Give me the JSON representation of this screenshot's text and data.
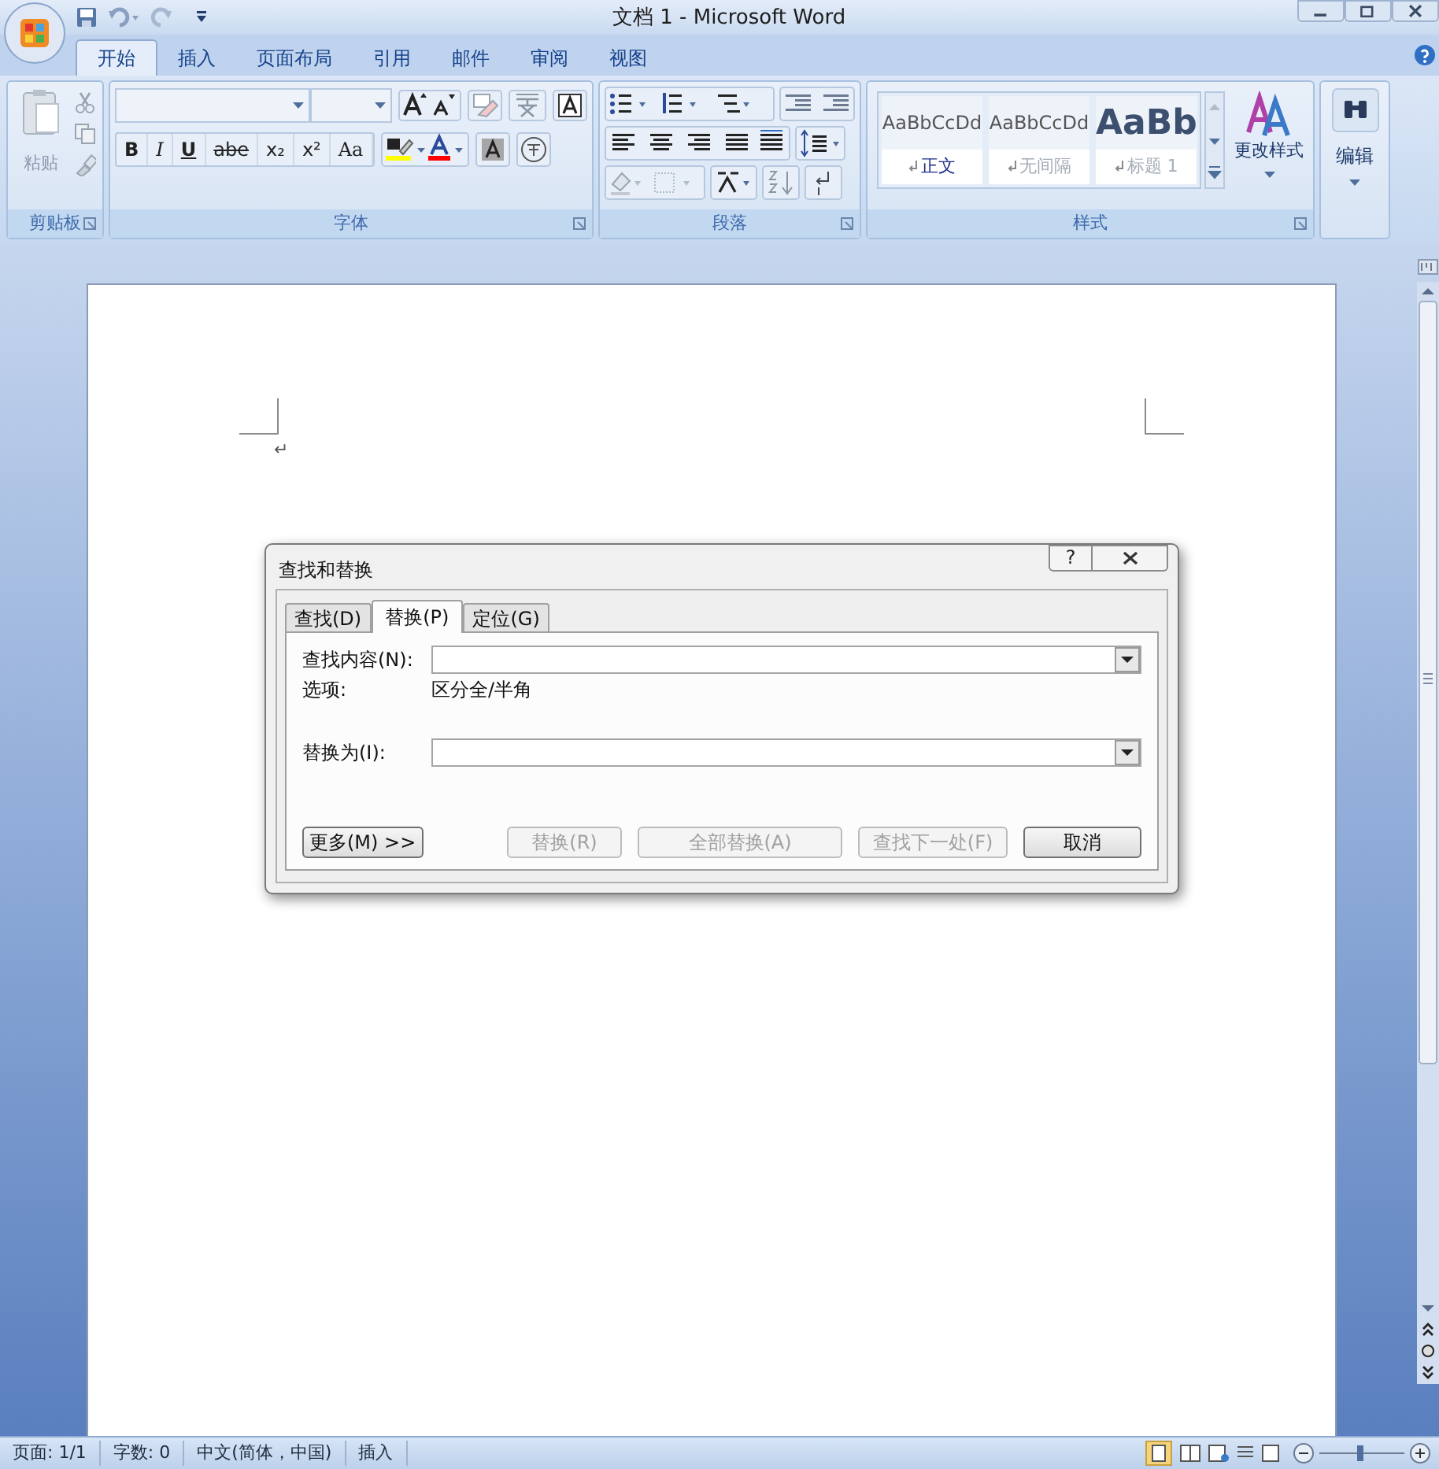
{
  "window": {
    "title": "文档 1 - Microsoft Word"
  },
  "ribbon_tabs": [
    {
      "label": "开始",
      "selected": true
    },
    {
      "label": "插入",
      "selected": false
    },
    {
      "label": "页面布局",
      "selected": false
    },
    {
      "label": "引用",
      "selected": false
    },
    {
      "label": "邮件",
      "selected": false
    },
    {
      "label": "审阅",
      "selected": false
    },
    {
      "label": "视图",
      "selected": false
    }
  ],
  "clipboard_group": {
    "label": "剪贴板",
    "paste_label": "粘贴"
  },
  "font_group": {
    "label": "字体",
    "format_buttons": [
      "B",
      "I",
      "U",
      "abe",
      "x₂",
      "x²",
      "Aa"
    ]
  },
  "paragraph_group": {
    "label": "段落"
  },
  "styles_group": {
    "label": "样式",
    "change_styles": "更改样式",
    "gallery": [
      {
        "preview": "AaBbCcDd",
        "name": "正文",
        "kind": "normal"
      },
      {
        "preview": "AaBbCcDd",
        "name": "无间隔",
        "kind": "muted"
      },
      {
        "preview": "AaBb",
        "name": "标题 1",
        "kind": "heading"
      }
    ]
  },
  "editing_group": {
    "label": "编辑"
  },
  "document": {
    "paragraph_mark": "↵"
  },
  "dialog": {
    "title": "查找和替换",
    "help": "?",
    "tabs": [
      {
        "label": "查找(D)",
        "selected": false
      },
      {
        "label": "替换(P)",
        "selected": true
      },
      {
        "label": "定位(G)",
        "selected": false
      }
    ],
    "find_label": "查找内容(N):",
    "options_label": "选项:",
    "options_value": "区分全/半角",
    "replace_label": "替换为(I):",
    "buttons": [
      {
        "label": "更多(M) >>",
        "disabled": false
      },
      {
        "label": "替换(R)",
        "disabled": true
      },
      {
        "label": "全部替换(A)",
        "disabled": true
      },
      {
        "label": "查找下一处(F)",
        "disabled": true
      },
      {
        "label": "取消",
        "disabled": false
      }
    ]
  },
  "status_bar": [
    "页面: 1/1",
    "字数: 0",
    "中文(简体，中国)",
    "插入"
  ]
}
